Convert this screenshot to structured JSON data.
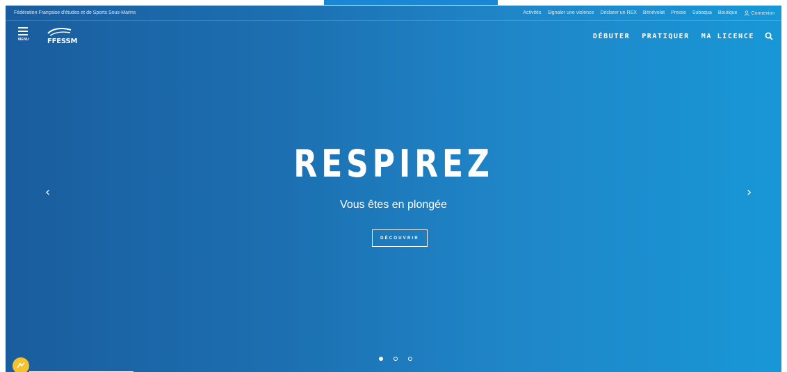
{
  "utility_bar": {
    "organization": "Fédération Française d'études et de Sports Sous-Marins",
    "links": [
      "Activités",
      "Signaler une violence",
      "Déclarer un REX",
      "Bénévolat",
      "Presse",
      "Subaqua",
      "Boutique"
    ],
    "login_label": "Connexion"
  },
  "header": {
    "menu_label": "MENU",
    "logo_text": "FFESSM",
    "nav": [
      "DÉBUTER",
      "PRATIQUER",
      "MA LICENCE"
    ]
  },
  "hero": {
    "title": "RESPIREZ",
    "subtitle": "Vous êtes en plongée",
    "cta_label": "DÉCOUVRIR",
    "prev_arrow": "‹",
    "next_arrow": "›",
    "slide_count": 3,
    "active_slide": 1
  },
  "colors": {
    "hero_gradient_start": "#1a5d9e",
    "hero_gradient_end": "#1897d6",
    "chat_widget": "#f3c22c"
  },
  "icons": {
    "menu": "hamburger-icon",
    "logo": "ffessm-wave-logo",
    "search": "search-icon",
    "login": "user-icon",
    "chat": "chat-icon"
  }
}
